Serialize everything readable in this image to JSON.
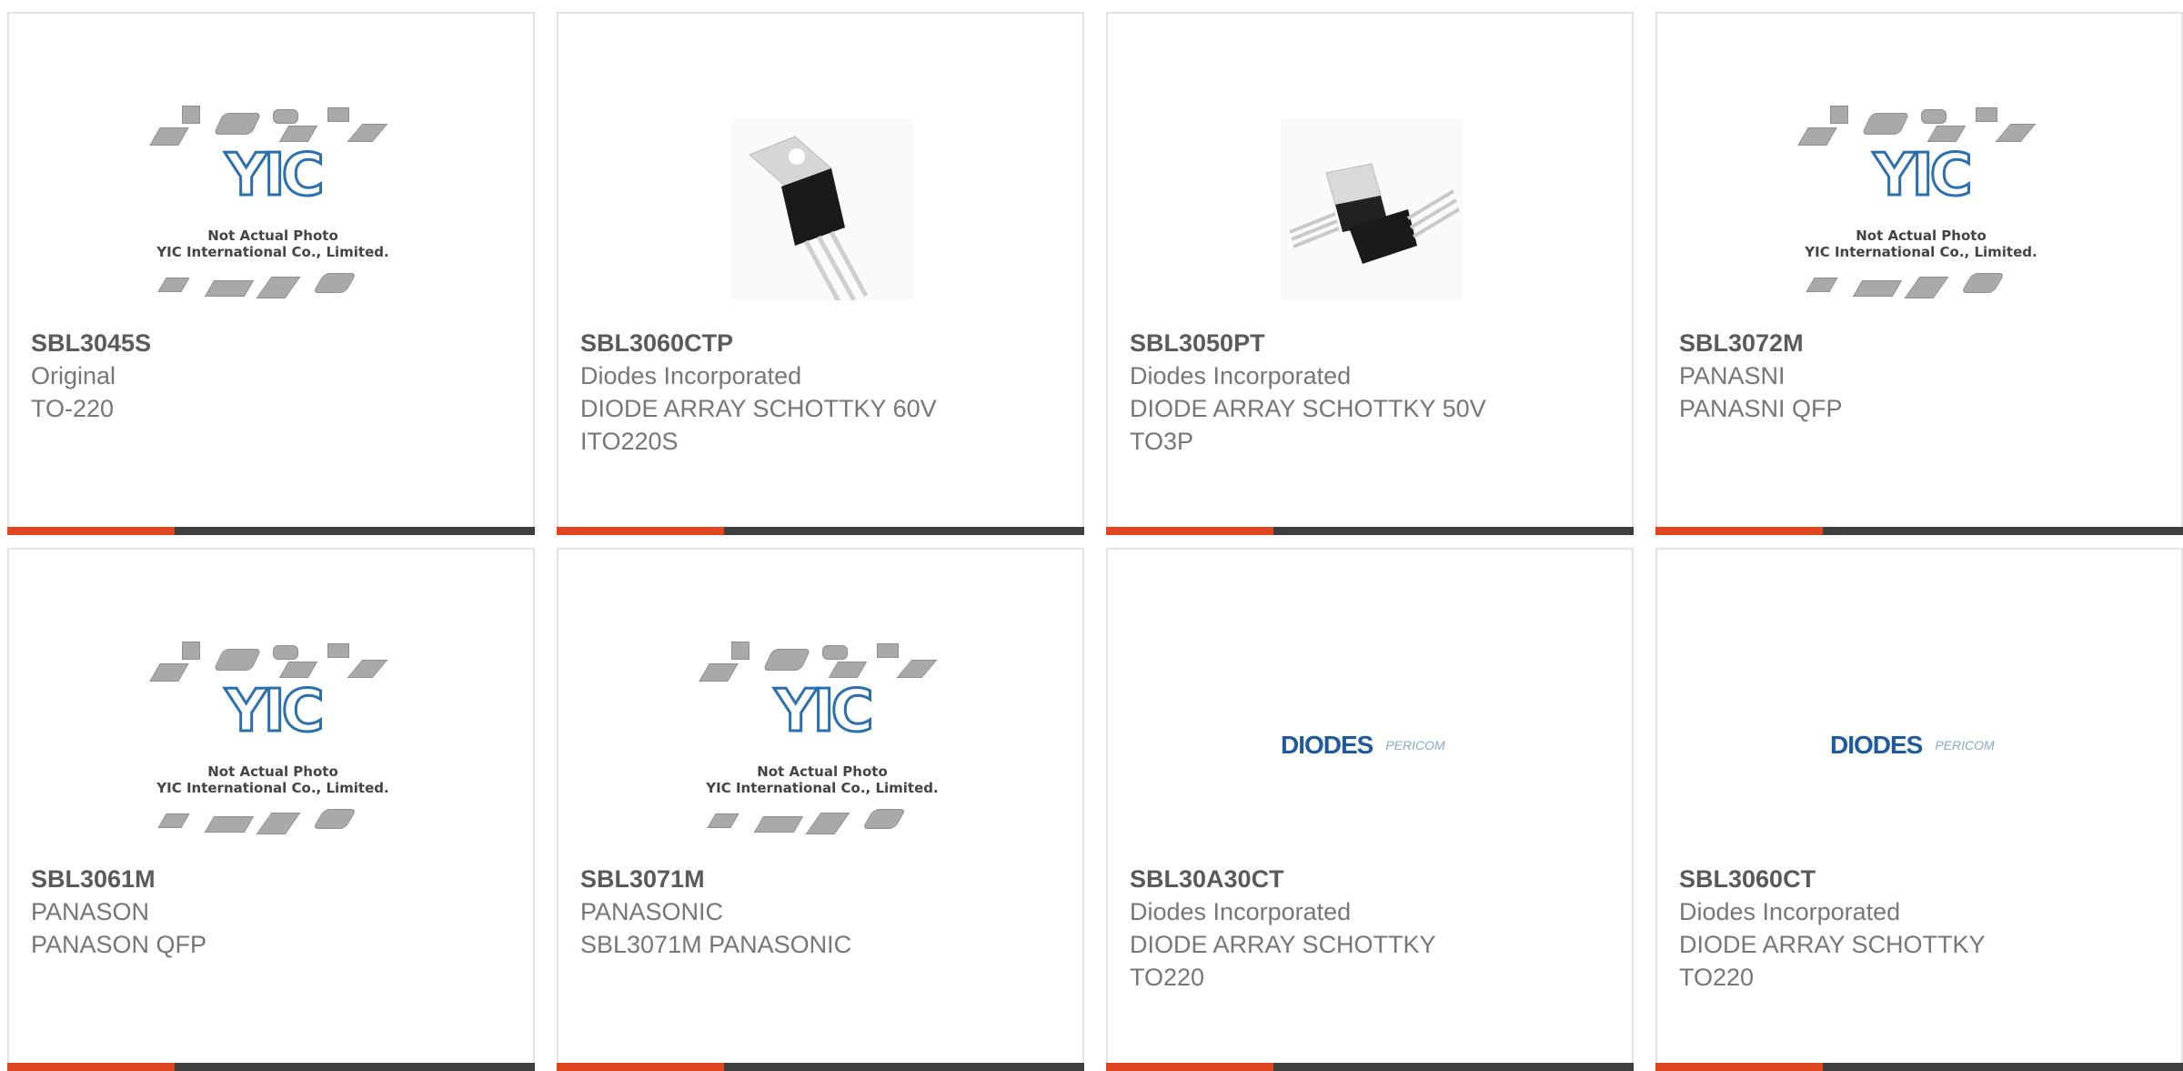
{
  "products": [
    {
      "part_number": "SBL3045S",
      "lines": [
        "Original",
        "TO-220"
      ],
      "image": "yic-placeholder",
      "image_note": [
        "Not Actual Photo",
        "YIC International Co., Limited."
      ],
      "image_logo": "YIC"
    },
    {
      "part_number": "SBL3060CTP",
      "lines": [
        "Diodes Incorporated",
        "DIODE ARRAY SCHOTTKY 60V",
        "ITO220S"
      ],
      "image": "to220-photo"
    },
    {
      "part_number": "SBL3050PT",
      "lines": [
        "Diodes Incorporated",
        "DIODE ARRAY SCHOTTKY 50V",
        "TO3P"
      ],
      "image": "to3p-photo"
    },
    {
      "part_number": "SBL3072M",
      "lines": [
        "PANASNI",
        "PANASNI QFP"
      ],
      "image": "yic-placeholder",
      "image_note": [
        "Not Actual Photo",
        "YIC International Co., Limited."
      ],
      "image_logo": "YIC"
    },
    {
      "part_number": "SBL3061M",
      "lines": [
        "PANASON",
        "PANASON QFP"
      ],
      "image": "yic-placeholder",
      "image_note": [
        "Not Actual Photo",
        "YIC International Co., Limited."
      ],
      "image_logo": "YIC"
    },
    {
      "part_number": "SBL3071M",
      "lines": [
        "PANASONIC",
        "SBL3071M PANASONIC"
      ],
      "image": "yic-placeholder",
      "image_note": [
        "Not Actual Photo",
        "YIC International Co., Limited."
      ],
      "image_logo": "YIC"
    },
    {
      "part_number": "SBL30A30CT",
      "lines": [
        "Diodes Incorporated",
        "DIODE ARRAY SCHOTTKY",
        "TO220"
      ],
      "image": "diodes-logo",
      "brand": [
        "DIODES",
        "PERICOM"
      ]
    },
    {
      "part_number": "SBL3060CT",
      "lines": [
        "Diodes Incorporated",
        "DIODE ARRAY SCHOTTKY",
        "TO220"
      ],
      "image": "diodes-logo",
      "brand": [
        "DIODES",
        "PERICOM"
      ]
    }
  ],
  "colors": {
    "accent": "#e0461f",
    "bar": "#3f3f3f",
    "border": "#e3e3e3",
    "yic_blue": "#2a6fb0",
    "diodes_blue": "#1f5a9e"
  }
}
